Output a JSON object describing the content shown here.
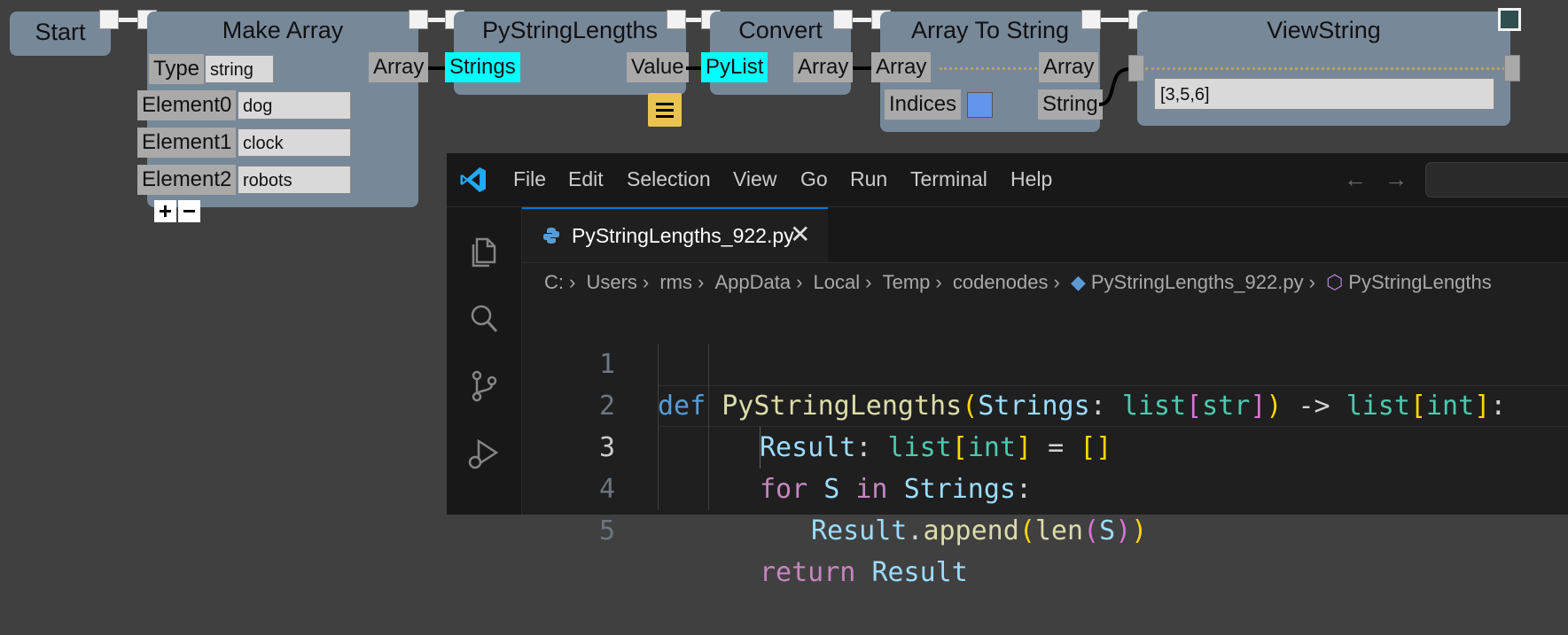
{
  "nodes": {
    "start": {
      "title": "Start"
    },
    "make_array": {
      "title": "Make Array",
      "type_label": "Type",
      "type_value": "string",
      "elements": [
        {
          "label": "Element0",
          "value": "dog"
        },
        {
          "label": "Element1",
          "value": "clock"
        },
        {
          "label": "Element2",
          "value": "robots"
        }
      ],
      "output_port": "Array",
      "add_symbol": "+",
      "remove_symbol": "−"
    },
    "py_string_lengths": {
      "title": "PyStringLengths",
      "input_port": "Strings",
      "output_port": "Value"
    },
    "convert": {
      "title": "Convert",
      "input_port": "PyList",
      "output_port": "Array"
    },
    "array_to_string": {
      "title": "Array To String",
      "input_port": "Array",
      "output_array": "Array",
      "indices_label": "Indices",
      "output_string": "String"
    },
    "view_string": {
      "title": "ViewString",
      "value": "[3,5,6]"
    }
  },
  "vscode": {
    "menu": [
      "File",
      "Edit",
      "Selection",
      "View",
      "Go",
      "Run",
      "Terminal",
      "Help"
    ],
    "tab": {
      "label": "PyStringLengths_922.py",
      "close": "✕"
    },
    "breadcrumb": [
      "C:",
      "Users",
      "rms",
      "AppData",
      "Local",
      "Temp",
      "codenodes",
      "PyStringLengths_922.py",
      "PyStringLengths"
    ],
    "line_numbers": [
      "1",
      "2",
      "3",
      "4",
      "5"
    ],
    "active_line": 3
  },
  "colors": {
    "node_bg": "#778899",
    "port_highlight": "#00ffff",
    "editor_bg": "#1f1f1f",
    "accent": "#0078d4"
  }
}
